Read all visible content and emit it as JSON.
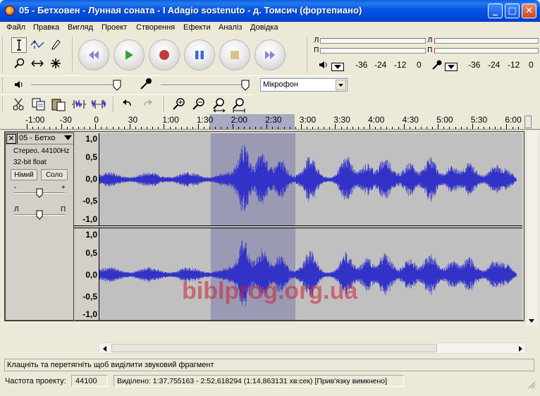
{
  "window": {
    "title": "05 - Бетховен - Лунная соната - I Adagio sostenuto - д. Томсич (фортепиано)",
    "minimize": "_",
    "maximize": "□",
    "close": "✕"
  },
  "menu": [
    {
      "label": "Файл"
    },
    {
      "label": "Правка"
    },
    {
      "label": "Вигляд"
    },
    {
      "label": "Проект"
    },
    {
      "label": "Створення"
    },
    {
      "label": "Ефекти"
    },
    {
      "label": "Аналіз"
    },
    {
      "label": "Довідка"
    }
  ],
  "meters": {
    "out_left": "Л",
    "out_right": "П",
    "in_left": "Л",
    "in_right": "П",
    "scale": [
      "-36",
      "-24",
      "-12",
      "0"
    ]
  },
  "mixer": {
    "input_source": "Мікрофон"
  },
  "ruler": {
    "labels": [
      "-1:00",
      "-30",
      "0",
      "30",
      "1:00",
      "1:30",
      "2:00",
      "2:30",
      "3:00",
      "3:30",
      "4:00",
      "4:30",
      "5:00",
      "5:30",
      "6:00"
    ]
  },
  "track": {
    "name": "05 - Бетхо",
    "format": "Стерео, 44100Hz",
    "bitdepth": "32-bit float",
    "mute": "Німий",
    "solo": "Соло",
    "gain_minus": "-",
    "gain_plus": "+",
    "pan_left": "Л",
    "pan_right": "П",
    "scale_top": [
      "1,0",
      "0,5",
      "0,0",
      "-0,5",
      "-1,0"
    ],
    "scale_bottom": [
      "1,0",
      "0,5",
      "0,0",
      "-0,5",
      "-1,0"
    ]
  },
  "watermark": "biblprog.org.ua",
  "status": {
    "hint": "Клацніть та перетягніть щоб виділити звуковий фрагмент",
    "rate_label": "Частота проекту:",
    "rate_value": "44100",
    "selection": "Виділено: 1:37,755163 - 2:52,618294 (1:14,863131 хв:сек)   [Прив'язку вимкнено]"
  },
  "colors": {
    "waveform": "#3232c8",
    "selection": "#9a9ab4",
    "watermark": "#cc2233"
  }
}
